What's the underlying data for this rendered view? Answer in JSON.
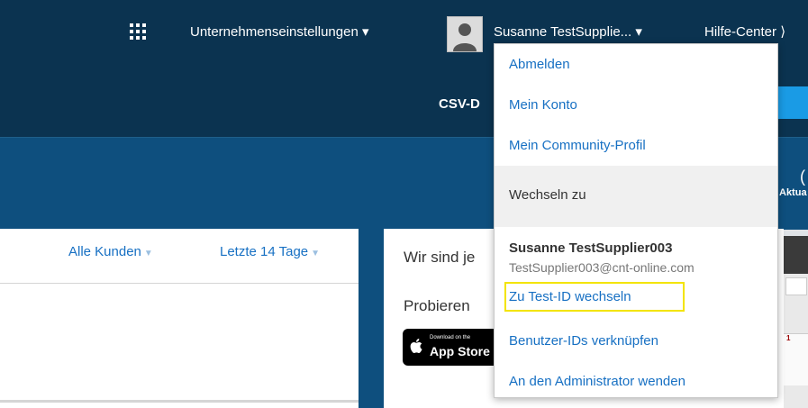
{
  "header": {
    "apps_icon": "grid-icon",
    "company_settings": "Unternehmenseinstellungen ▾",
    "user_menu": "Susanne TestSupplie... ▾",
    "help_center": "Hilfe-Center ⟩",
    "csv_label": "CSV-D"
  },
  "side_info": {
    "number": "(",
    "label": "Aktua"
  },
  "filters": {
    "customers": "Alle Kunden",
    "period": "Letzte 14 Tage"
  },
  "promo": {
    "line1": "Wir sind je",
    "line2": "Probieren",
    "appstore_small": "Download on the",
    "appstore_big": "App Store"
  },
  "thumb": {
    "value": "1"
  },
  "dropdown": {
    "logout": "Abmelden",
    "my_account": "Mein Konto",
    "community_profile": "Mein Community-Profil",
    "switch_to": "Wechseln zu",
    "user_name": "Susanne TestSupplier003",
    "user_email": "TestSupplier003@cnt-online.com",
    "switch_test_id": "Zu Test-ID wechseln",
    "link_user_ids": "Benutzer-IDs verknüpfen",
    "contact_admin": "An den Administrator wenden"
  },
  "colors": {
    "header_bg": "#0b3350",
    "band_bg": "#0e4f7e",
    "link": "#1770c3",
    "highlight": "#f3e400"
  }
}
